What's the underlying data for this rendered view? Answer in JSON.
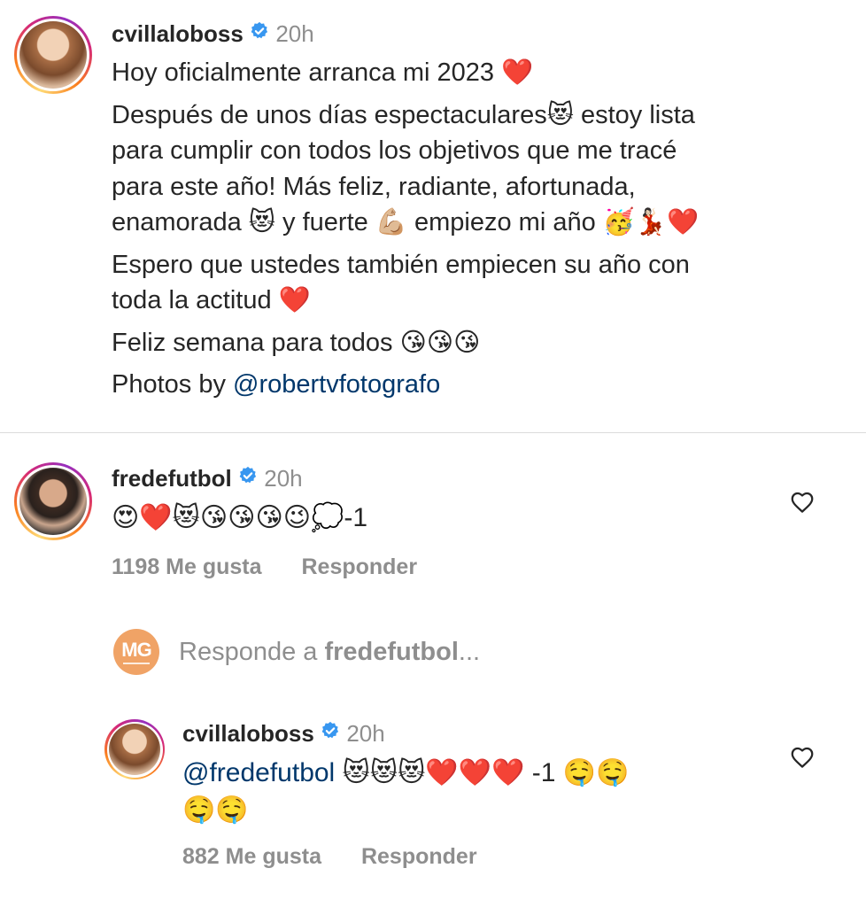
{
  "post": {
    "username": "cvillaloboss",
    "time": "20h",
    "lines": [
      "Hoy oficialmente arranca mi 2023 ❤️",
      "Después de unos días espectaculares😻 estoy lista",
      "para cumplir con todos los objetivos que me tracé",
      "para este año! Más feliz, radiante, afortunada,",
      "enamorada 😻 y fuerte 💪🏼 empiezo mi año 🥳💃🏻❤️",
      "Espero que ustedes también empiecen su año con",
      "toda la actitud ❤️",
      "Feliz semana para todos 😘😘😘"
    ],
    "photos_prefix": "Photos by ",
    "photos_mention": "@robertvfotografo"
  },
  "comment1": {
    "username": "fredefutbol",
    "time": "20h",
    "text": "😍❤️😻😘😘😘😉💭-1",
    "likes": "1198 Me gusta",
    "reply": "Responder",
    "like_icon": "heart-outline-icon"
  },
  "reply_prompt": {
    "logo_text": "MG",
    "prefix": "Responde a ",
    "username": "fredefutbol",
    "suffix": "..."
  },
  "comment2": {
    "username": "cvillaloboss",
    "time": "20h",
    "mention": "@fredefutbol",
    "line1_rest": " 😻😻😻❤️❤️❤️ -1 🤤🤤",
    "line2": "🤤🤤",
    "likes": "882 Me gusta",
    "reply": "Responder",
    "like_icon": "heart-outline-icon"
  },
  "colors": {
    "verified": "#3897f0",
    "mention": "#00376b",
    "muted": "#8e8e8e",
    "mg_logo": "#f0a366"
  }
}
